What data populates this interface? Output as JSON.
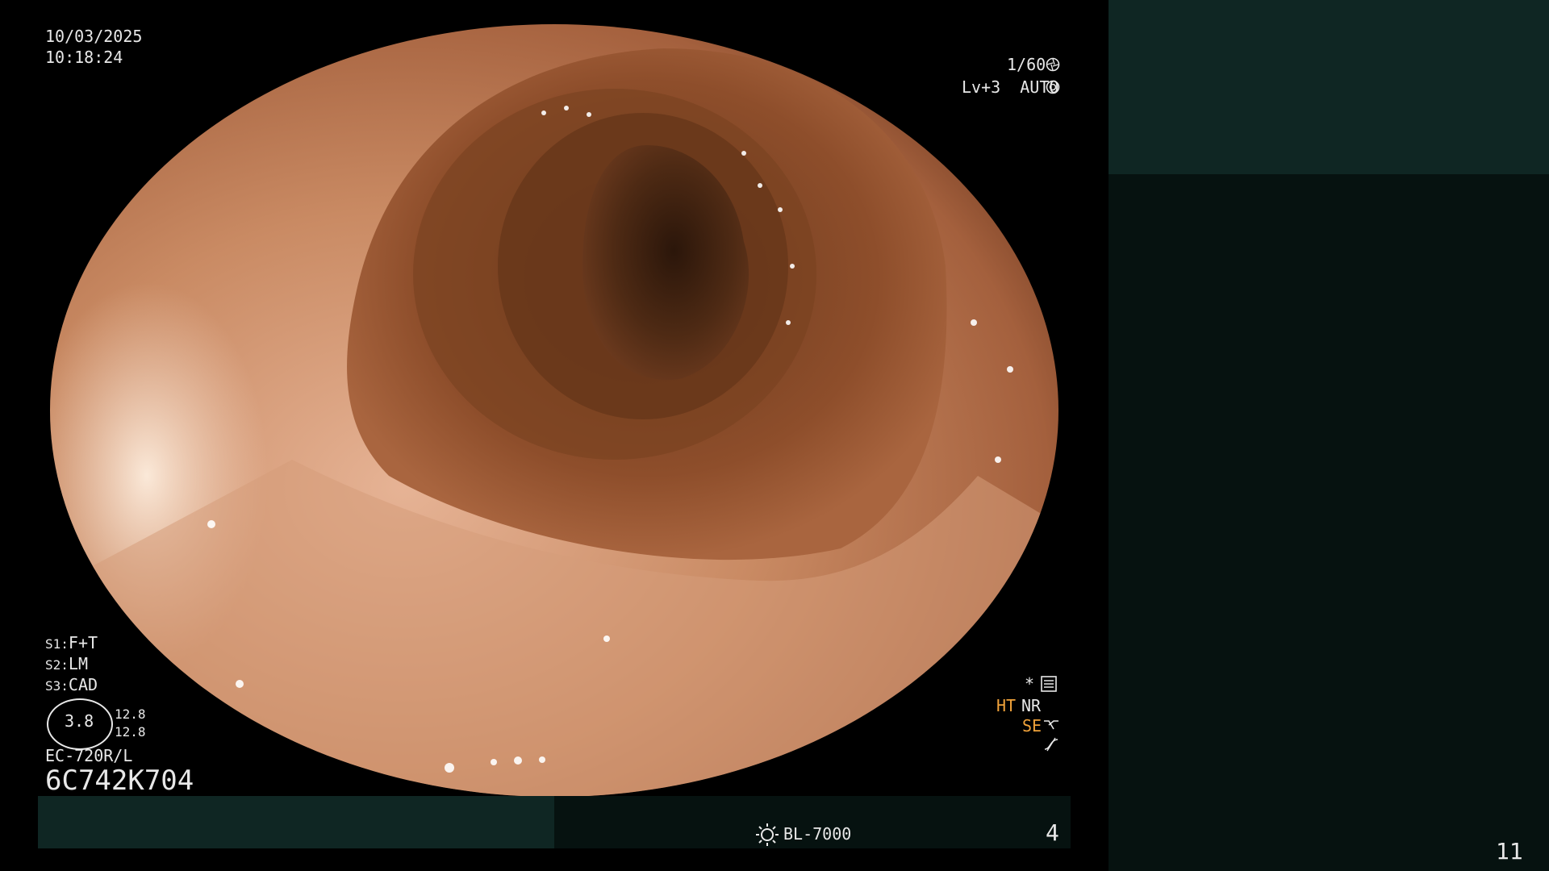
{
  "overlay": {
    "date": "10/03/2025",
    "time": "10:18:24",
    "shutter": "1/60",
    "level_mode": "Lv+3  AUTO",
    "s1": "F+T",
    "s2": "LM",
    "s3": "CAD",
    "s1_key": "S1:",
    "s2_key": "S2:",
    "s3_key": "S3:",
    "zoom_value": "3.8",
    "zoom_a": "12.8",
    "zoom_b": "12.8",
    "scope_model": "EC-720R/L",
    "scope_serial": "6C742K704",
    "ht": "HT",
    "nr": "NR",
    "se": "SE",
    "asterisk": "*",
    "light_source": "BL-7000",
    "page_left": "4",
    "page_right": "11"
  },
  "colors": {
    "panel_teal": "#0f2623",
    "panel_dark": "#061210",
    "label_orange": "#f0a23a"
  },
  "icons": [
    "aperture-icon",
    "brightness-icon",
    "settings-list-icon",
    "structure-enhance-icon",
    "curve-icon",
    "light-source-icon"
  ]
}
